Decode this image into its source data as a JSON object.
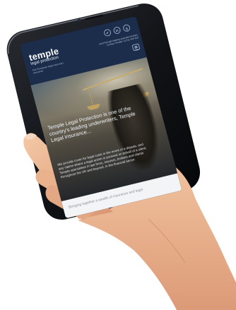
{
  "site": {
    "logo_word": "temple",
    "logo_sub": "legal protection",
    "tagline": "Pan-European legal expenses insurance"
  },
  "header": {
    "social_icons": [
      "twitter-icon",
      "linkedin-icon",
      "google-plus-icon"
    ],
    "contact_line1": "Sold through leading specialist brokers",
    "contact_line2": "Contact Temple: 01732 448 400"
  },
  "hero": {
    "headline": "Temple Legal Protection is one of the country's leading underwriters, Temple Legal insurance...",
    "body": "We provide cover for legal costs in the event of a dispute, and any claims where a legal action is pursued on behalf of a client. Temple specialises in law firms, insurers, brokers and clients throughout the UK and beyond, in the financial sector."
  },
  "footer": {
    "text": "Bringing together a wealth of insurance and legal"
  },
  "colors": {
    "header_bg": "#1b2d4a",
    "accent_gold": "#c7ab6d",
    "bottom_bg": "#f3f4f6"
  }
}
